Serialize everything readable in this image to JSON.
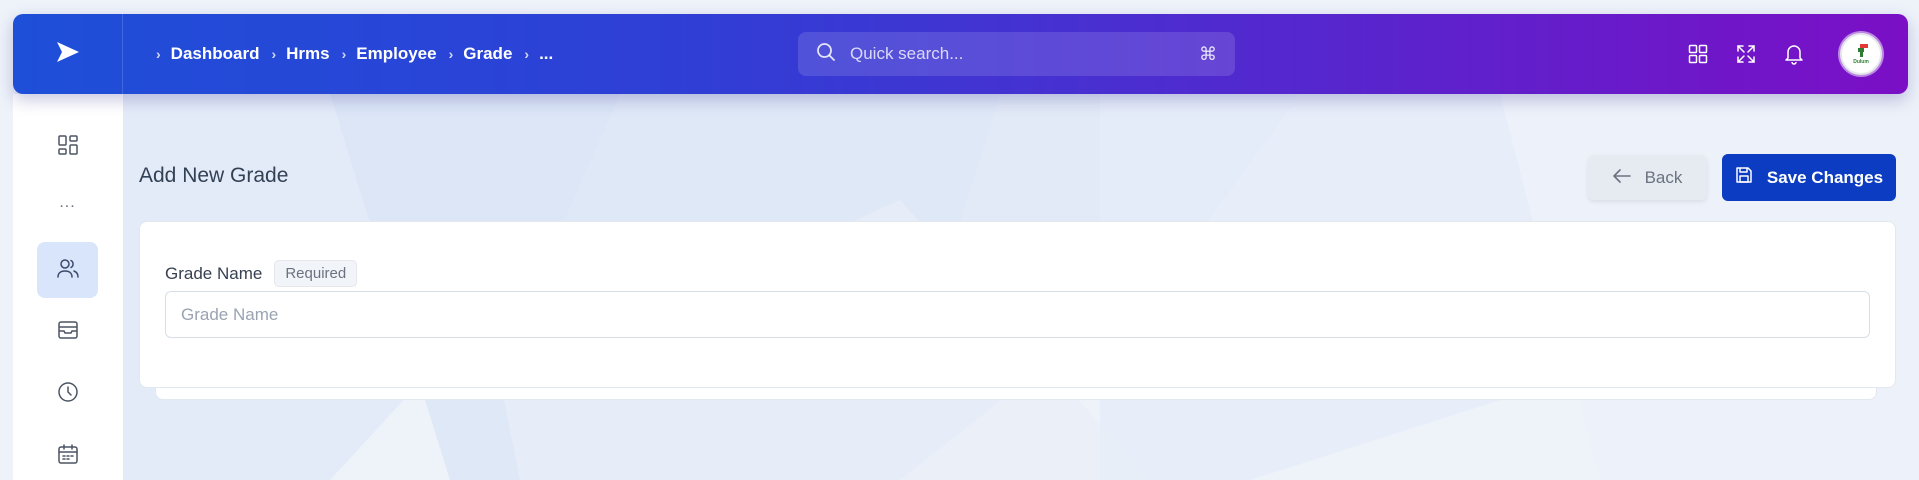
{
  "colors": {
    "topbar_start": "#1e4fd8",
    "topbar_end": "#7b0fc6",
    "primary_button": "#0b3cc1",
    "sidebar_active": "#d9e5fb"
  },
  "topbar": {
    "logo_icon": "send-arrow-icon",
    "breadcrumb": [
      "Dashboard",
      "Hrms",
      "Employee",
      "Grade",
      "..."
    ],
    "search": {
      "placeholder": "Quick search...",
      "shortcut": "⌘"
    },
    "actions": [
      "apps-grid-icon",
      "fullscreen-icon",
      "bell-icon"
    ],
    "avatar_label": "Dulum"
  },
  "sidebar": {
    "items": [
      {
        "icon": "dashboard-grid-icon",
        "active": false
      },
      {
        "icon": "more-dots",
        "label": "...",
        "active": false
      },
      {
        "icon": "users-icon",
        "active": true
      },
      {
        "icon": "inbox-icon",
        "active": false
      },
      {
        "icon": "clock-icon",
        "active": false
      },
      {
        "icon": "calendar-icon",
        "active": false
      }
    ]
  },
  "page": {
    "title": "Add New Grade",
    "back_label": "Back",
    "save_label": "Save Changes"
  },
  "form": {
    "grade_name": {
      "label": "Grade Name",
      "badge": "Required",
      "placeholder": "Grade Name",
      "value": ""
    }
  }
}
